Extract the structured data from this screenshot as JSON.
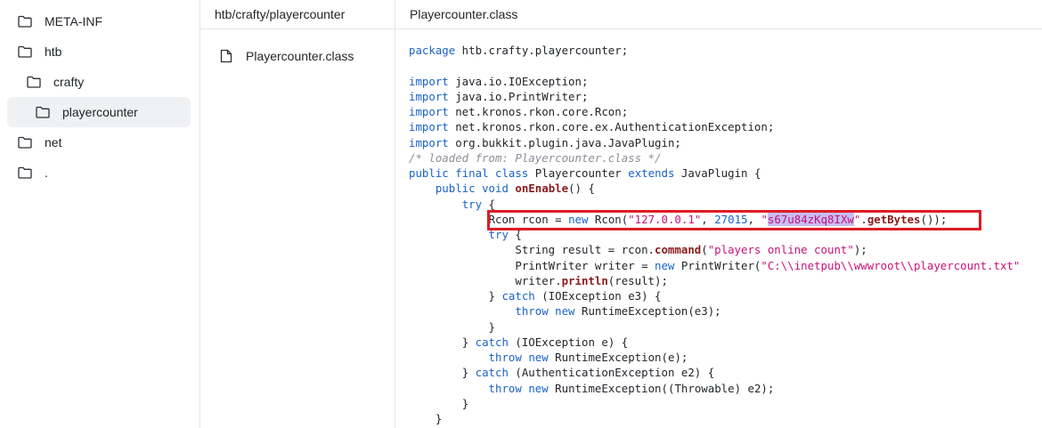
{
  "tree": {
    "items": [
      {
        "label": "META-INF"
      },
      {
        "label": "htb"
      },
      {
        "label": "crafty"
      },
      {
        "label": "playercounter"
      },
      {
        "label": "net"
      },
      {
        "label": "."
      }
    ]
  },
  "files": {
    "header": "htb/crafty/playercounter",
    "items": [
      {
        "label": "Playercounter.class"
      }
    ]
  },
  "code": {
    "header": "Playercounter.class",
    "tokens": {
      "package": "package",
      "pkg_name": " htb.crafty.playercounter;",
      "import": "import",
      "imp1": " java.io.IOException;",
      "imp2": " java.io.PrintWriter;",
      "imp3": " net.kronos.rkon.core.Rcon;",
      "imp4": " net.kronos.rkon.core.ex.AuthenticationException;",
      "imp5": " org.bukkit.plugin.java.JavaPlugin;",
      "comment": "/* loaded from: Playercounter.class */",
      "public": "public",
      "final": "final",
      "class": "class",
      "class_name": " Playercounter ",
      "extends": "extends",
      "extends_rest": " JavaPlugin {",
      "void": "void",
      "onEnable": "onEnable",
      "onEnable_rest": "() {",
      "try": "try",
      "brace_open": " {",
      "rcon_decl": "Rcon rcon = ",
      "new": "new",
      "rcon_ctor": " Rcon(",
      "ip": "\"127.0.0.1\"",
      "comma": ", ",
      "port": "27015",
      "quote": "\"",
      "password": "s67u84zKq8IXw",
      "getBytes": "getBytes",
      "rcon_end": "());",
      "result_decl": "String result = rcon.",
      "command": "command",
      "paren_open": "(",
      "players_str": "\"players online count\"",
      "paren_close": ");",
      "writer_decl": "PrintWriter writer = ",
      "pw_ctor": " PrintWriter(",
      "path_str": "\"C:\\\\inetpub\\\\wwwroot\\\\playercount.txt\"",
      "writer_call": "writer.",
      "println": "println",
      "println_rest": "(result);",
      "catch": "catch",
      "catch_io3": " (IOException e3) {",
      "throw": "throw",
      "rte": " RuntimeException(e3);",
      "catch_io": " (IOException e) {",
      "rte_e": " RuntimeException(e);",
      "catch_auth": " (AuthenticationException e2) {",
      "rte_e2": " RuntimeException((Throwable) e2);",
      "close": "}",
      "close_catch": "} "
    }
  }
}
